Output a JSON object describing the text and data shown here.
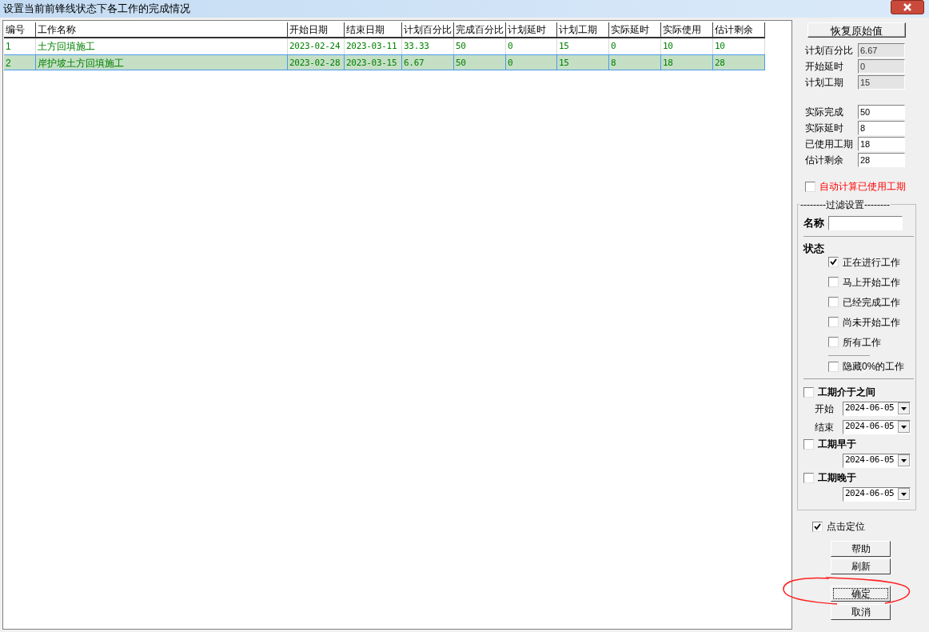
{
  "window": {
    "title": "设置当前前锋线状态下各工作的完成情况"
  },
  "table": {
    "columns": [
      "编号",
      "工作名称",
      "开始日期",
      "结束日期",
      "计划百分比",
      "完成百分比",
      "计划延时",
      "计划工期",
      "实际延时",
      "实际使用",
      "估计剩余"
    ],
    "rows": [
      {
        "selected": false,
        "cells": [
          "1",
          "土方回填施工",
          "2023-02-24",
          "2023-03-11",
          "33.33",
          "50",
          "0",
          "15",
          "0",
          "10",
          "10"
        ]
      },
      {
        "selected": true,
        "cells": [
          "2",
          "岸护坡土方回填施工",
          "2023-02-28",
          "2023-03-15",
          "6.67",
          "50",
          "0",
          "15",
          "8",
          "18",
          "28"
        ]
      }
    ]
  },
  "restore_button": "恢复原始值",
  "plan_fields": [
    {
      "label": "计划百分比",
      "value": "6.67",
      "readonly": true
    },
    {
      "label": "开始延时",
      "value": "0",
      "readonly": true
    },
    {
      "label": "计划工期",
      "value": "15",
      "readonly": true
    }
  ],
  "actual_fields": [
    {
      "label": "实际完成",
      "value": "50",
      "readonly": false
    },
    {
      "label": "实际延时",
      "value": "8",
      "readonly": false
    },
    {
      "label": "已使用工期",
      "value": "18",
      "readonly": false
    },
    {
      "label": "估计剩余",
      "value": "28",
      "readonly": false
    }
  ],
  "auto_calc": {
    "label": "自动计算已使用工期",
    "checked": false
  },
  "filter": {
    "title": "--------过滤设置--------",
    "name_label": "名称",
    "status_label": "状态",
    "statuses": [
      {
        "label": "正在进行工作",
        "checked": true
      },
      {
        "label": "马上开始工作",
        "checked": false
      },
      {
        "label": "已经完成工作",
        "checked": false
      },
      {
        "label": "尚未开始工作",
        "checked": false
      },
      {
        "label": "所有工作",
        "checked": false
      }
    ],
    "hide_zero": {
      "label": "隐藏0%的工作",
      "checked": false
    },
    "between": {
      "label": "工期介于之间",
      "checked": false,
      "start_label": "开始",
      "start": "2024-06-05",
      "end_label": "结束",
      "end": "2024-06-05"
    },
    "earlier": {
      "label": "工期早于",
      "checked": false,
      "date": "2024-06-05"
    },
    "later": {
      "label": "工期晚于",
      "checked": false,
      "date": "2024-06-05"
    }
  },
  "locate": {
    "label": "点击定位",
    "checked": true
  },
  "buttons": [
    {
      "label": "帮助",
      "focused": false
    },
    {
      "label": "刷新",
      "focused": false
    },
    {
      "label": "确定",
      "focused": true
    },
    {
      "label": "取消",
      "focused": false
    }
  ]
}
